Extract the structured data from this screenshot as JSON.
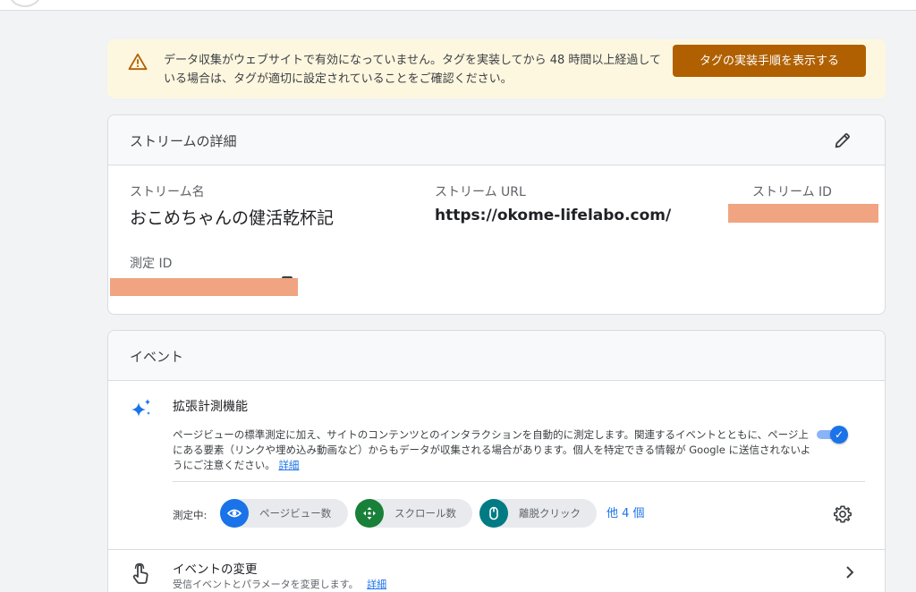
{
  "alert": {
    "message": "データ収集がウェブサイトで有効になっていません。タグを実装してから 48 時間以上経過している場合は、タグが適切に設定されていることをご確認ください。",
    "button_label": "タグの実装手順を表示する",
    "icon": "warning-icon",
    "accent": "#b06000",
    "background": "#fef7e0"
  },
  "stream_details": {
    "title": "ストリームの詳細",
    "edit_icon": "pencil-icon",
    "name_label": "ストリーム名",
    "name_value": "おこめちゃんの健活乾杯記",
    "url_label": "ストリーム URL",
    "url_value": "https://okome-lifelabo.com/",
    "id_label": "ストリーム ID",
    "measurement_id_label": "測定 ID",
    "redaction_color": "#f0a482"
  },
  "events": {
    "title": "イベント",
    "enhanced": {
      "icon": "sparkle-icon",
      "title": "拡張計測機能",
      "description": "ページビューの標準測定に加え、サイトのコンテンツとのインタラクションを自動的に測定します。関連するイベントとともに、ページ上にある要素（リンクや埋め込み動画など）からもデータが収集される場合があります。個人を特定できる情報が Google に送信されないようにご注意ください。",
      "link": "詳細",
      "toggle_on": true
    },
    "measuring": {
      "label": "測定中:",
      "chips": [
        {
          "label": "ページビュー数",
          "icon": "eye-icon",
          "color": "#1a73e8"
        },
        {
          "label": "スクロール数",
          "icon": "scroll-icon",
          "color": "#188038"
        },
        {
          "label": "離脱クリック",
          "icon": "mouse-icon",
          "color": "#007b83"
        }
      ],
      "more": "他 4 個",
      "settings_icon": "gear-icon"
    },
    "modify": {
      "icon": "touch-icon",
      "title": "イベントの変更",
      "description": "受信イベントとパラメータを変更します。",
      "link": "詳細",
      "chevron": "chevron-right-icon"
    }
  }
}
